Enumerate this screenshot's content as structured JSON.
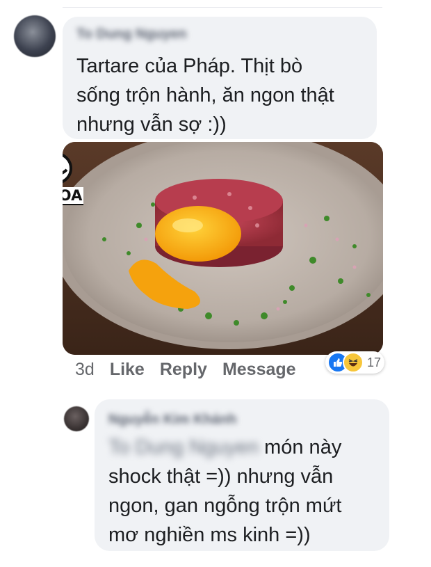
{
  "comment1": {
    "author": "To Dung Nguyen",
    "lines": [
      "Tartare của Pháp. Thịt bò",
      "sống trộn hành, ăn ngon thật",
      "nhưng vẫn sợ :))"
    ],
    "image_watermark": "NGOA",
    "meta": {
      "time": "3d",
      "like_label": "Like",
      "reply_label": "Reply",
      "message_label": "Message",
      "reaction_icons": [
        "like-icon",
        "haha-icon"
      ],
      "reaction_count": "17"
    }
  },
  "comment2": {
    "author": "Nguyễn Kim Khánh",
    "mention": "To Dung Nguyen",
    "line1_rest": " món này",
    "lines": [
      "shock thật =)) nhưng vẫn",
      "ngon, gan ngỗng trộn mứt",
      "mơ nghiền ms kinh =))"
    ]
  },
  "colors": {
    "bubble": "#f0f2f5",
    "meta_text": "#65676b",
    "like_blue": "#1877f2",
    "haha_yellow": "#f7c63a"
  }
}
